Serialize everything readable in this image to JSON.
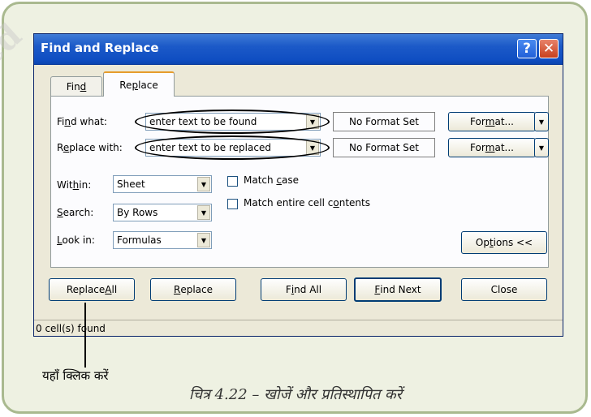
{
  "dialog": {
    "title": "Find and Replace",
    "help_glyph": "?",
    "close_glyph": "✕"
  },
  "tabs": [
    {
      "pre": "Fin",
      "key": "d",
      "post": ""
    },
    {
      "pre": "Re",
      "key": "p",
      "post": "lace"
    }
  ],
  "find": {
    "label_pre": "Fi",
    "label_key": "n",
    "label_post": "d what:",
    "value": "enter text to be found",
    "format_status": "No Format Set",
    "format_pre": "For",
    "format_key": "m",
    "format_post": "at..."
  },
  "replace": {
    "label_pre": "R",
    "label_key": "e",
    "label_post": "place with:",
    "value": "enter text to be replaced",
    "format_status": "No Format Set",
    "format_pre": "For",
    "format_key": "m",
    "format_post": "at..."
  },
  "options": {
    "within": {
      "pre": "Wit",
      "key": "h",
      "post": "in:",
      "value": "Sheet"
    },
    "search": {
      "pre": "",
      "key": "S",
      "post": "earch:",
      "value": "By Rows"
    },
    "lookin": {
      "pre": "",
      "key": "L",
      "post": "ook in:",
      "value": "Formulas"
    },
    "match_case": {
      "pre": "Match ",
      "key": "c",
      "post": "ase",
      "checked": false
    },
    "match_entire": {
      "pre": "Match entire cell c",
      "key": "o",
      "post": "ntents",
      "checked": false
    },
    "options_btn": {
      "pre": "Op",
      "key": "t",
      "post": "ions <<"
    }
  },
  "buttons": {
    "replace_all": {
      "pre": "Replace ",
      "key": "A",
      "post": "ll"
    },
    "replace": {
      "pre": "",
      "key": "R",
      "post": "eplace"
    },
    "find_all": {
      "pre": "F",
      "key": "i",
      "post": "nd All"
    },
    "find_next": {
      "pre": "",
      "key": "F",
      "post": "ind Next"
    },
    "close": "Close"
  },
  "status": "0 cell(s) found",
  "annotation": {
    "callout": "यहाँ क्लिक करें",
    "caption": "चित्र 4.22 – खोजें और प्रतिस्थापित करें"
  }
}
